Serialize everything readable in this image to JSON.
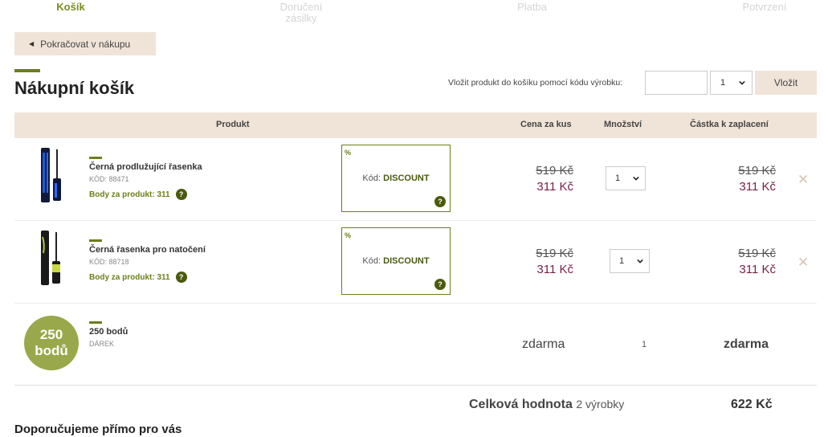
{
  "steps": [
    "Košík",
    "Doručení\nzásilky",
    "Platba",
    "Potvrzení"
  ],
  "continue_label": "Pokračovat v nákupu",
  "page_title": "Nákupní košík",
  "code_entry": {
    "label": "Vložit produkt do košíku pomocí kódu výrobku:",
    "qty": "1",
    "button": "Vložit"
  },
  "table_headers": {
    "product": "Produkt",
    "unit_price": "Cena za kus",
    "quantity": "Množství",
    "amount": "Částka k zaplacení"
  },
  "items": [
    {
      "name": "Černá prodlužující řasenka",
      "code": "KÓD: 88471",
      "points": "Body za produkt: 311",
      "discount_pct": "%",
      "discount_code_label": "Kód:",
      "discount_code": "DISCOUNT",
      "price_old": "519 Kč",
      "price_new": "311 Kč",
      "qty": "1",
      "total_old": "519 Kč",
      "total_new": "311 Kč"
    },
    {
      "name": "Černá řasenka pro natočení",
      "code": "KÓD: 88718",
      "points": "Body za produkt: 311",
      "discount_pct": "%",
      "discount_code_label": "Kód:",
      "discount_code": "DISCOUNT",
      "price_old": "519 Kč",
      "price_new": "311 Kč",
      "qty": "1",
      "total_old": "519 Kč",
      "total_new": "311 Kč"
    }
  ],
  "gift": {
    "circle_top": "250",
    "circle_bottom": "bodů",
    "name": "250 bodů",
    "type": "DÁREK",
    "price": "zdarma",
    "qty": "1",
    "total": "zdarma"
  },
  "total": {
    "label": "Celková hodnota",
    "sub": "2 výrobky",
    "value": "622 Kč"
  },
  "recommend": "Doporučujeme přímo pro vás",
  "remove_glyph": "✕",
  "colors": {
    "accent": "#6b7f1a",
    "price_new": "#7a2048",
    "beige": "#f0e4d8"
  }
}
